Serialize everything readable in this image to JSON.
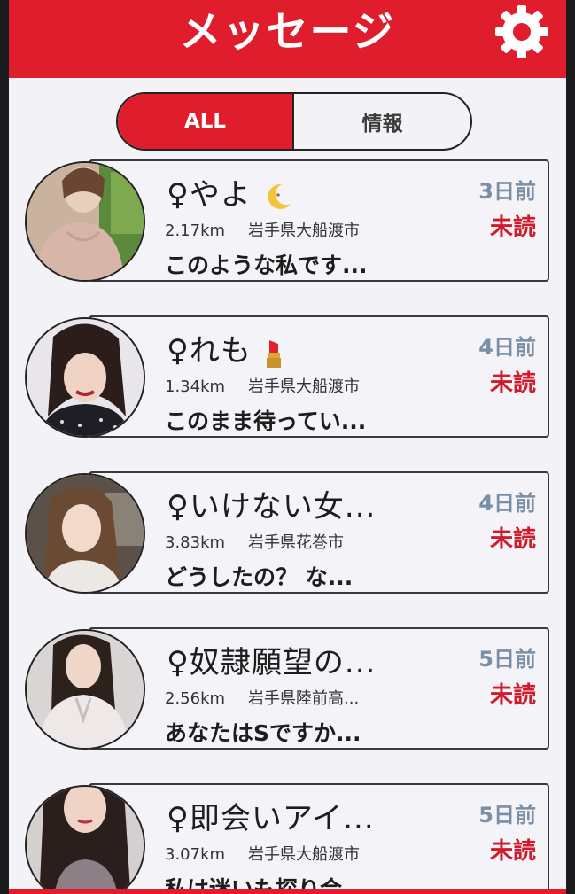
{
  "header": {
    "title": "メッセージ",
    "settings_icon": "gear-icon"
  },
  "tabs": [
    {
      "label": "ALL",
      "active": true
    },
    {
      "label": "情報",
      "active": false
    }
  ],
  "messages": [
    {
      "name": "♀やよ",
      "emoji": "crescent-moon",
      "distance": "2.17km",
      "location": "岩手県大船渡市",
      "preview": "このような私です...",
      "time": "3日前",
      "status": "未読"
    },
    {
      "name": "♀れも",
      "emoji": "lipstick",
      "distance": "1.34km",
      "location": "岩手県大船渡市",
      "preview": "このまま待ってい...",
      "time": "4日前",
      "status": "未読"
    },
    {
      "name": "♀いけない女...",
      "emoji": "",
      "distance": "3.83km",
      "location": "岩手県花巻市",
      "preview": "どうしたの？ な...",
      "time": "4日前",
      "status": "未読"
    },
    {
      "name": "♀奴隷願望の...",
      "emoji": "",
      "distance": "2.56km",
      "location": "岩手県陸前高...",
      "preview": "あなたはSですか...",
      "time": "5日前",
      "status": "未読"
    },
    {
      "name": "♀即会いアイ...",
      "emoji": "",
      "distance": "3.07km",
      "location": "岩手県大船渡市",
      "preview": "私は迷いも探り合...",
      "time": "5日前",
      "status": "未読"
    }
  ],
  "colors": {
    "accent": "#e01d2c",
    "time": "#7a8fa6",
    "unread": "#d21a2a"
  }
}
